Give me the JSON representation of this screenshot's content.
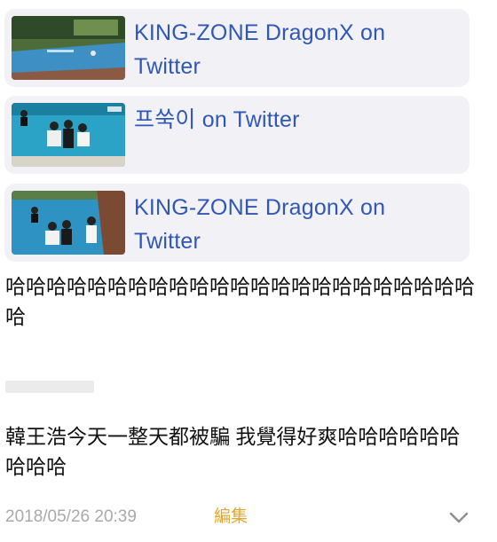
{
  "cards": [
    {
      "title": "KING-ZONE DragonX on Twitter",
      "thumbnail": "pool-photo-1"
    },
    {
      "title": "프쑥이 on Twitter",
      "thumbnail": "pool-photo-2"
    },
    {
      "title": "KING-ZONE DragonX on Twitter",
      "thumbnail": "pool-photo-3"
    }
  ],
  "post": {
    "laugh_text": "哈哈哈哈哈哈哈哈哈哈哈哈哈哈哈哈哈哈哈哈哈哈哈哈",
    "comment_text": "韓王浩今天一整天都被騙 我覺得好爽哈哈哈哈哈哈哈哈哈"
  },
  "footer": {
    "timestamp": "2018/05/26 20:39",
    "edit_label": "編集",
    "expand_icon": "chevron-down-icon"
  },
  "colors": {
    "link": "#2f57b8",
    "card_bg": "#f2f2f6",
    "timestamp": "#a9a9ad",
    "edit": "#e4a62b"
  }
}
